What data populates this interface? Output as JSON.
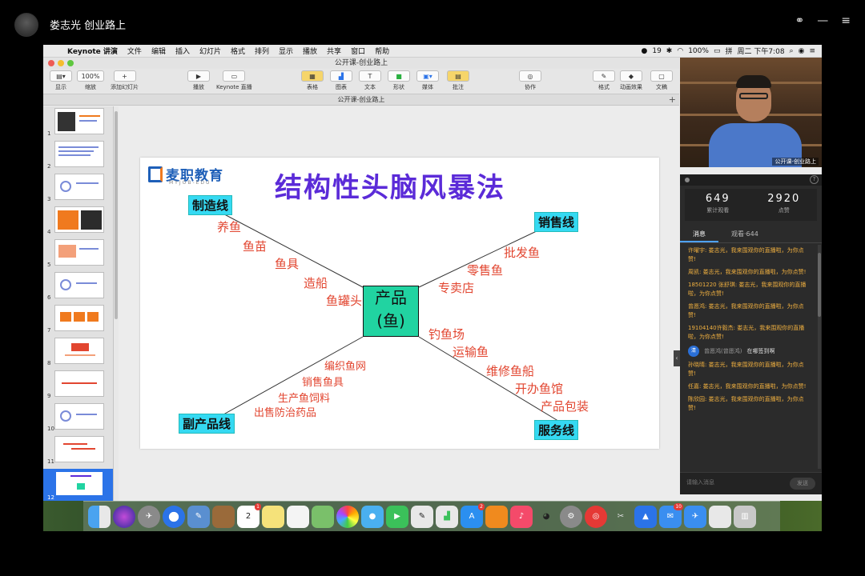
{
  "stream": {
    "host_title": "娄志光 创业路上",
    "icons": [
      "link-icon",
      "minimize-icon",
      "menu-icon"
    ]
  },
  "mac": {
    "menubar": {
      "items": [
        "Keynote 讲演",
        "文件",
        "编辑",
        "插入",
        "幻灯片",
        "格式",
        "排列",
        "显示",
        "播放",
        "共享",
        "窗口",
        "帮助"
      ],
      "right_items": [
        "19",
        "100%",
        "拼",
        "周二 下午7:08"
      ]
    },
    "window_title": "公开课-创业路上",
    "toolbar": {
      "view": "显示",
      "zoom_value": "100%",
      "zoom": "缩放",
      "add_slide": "添加幻灯片",
      "play": "播放",
      "keynote_live": "Keynote 直播",
      "table": "表格",
      "chart": "图表",
      "text": "文本",
      "shape": "形状",
      "media": "媒体",
      "comment": "批注",
      "collaborate": "协作",
      "format": "格式",
      "animate": "动画效果",
      "document": "文稿"
    },
    "doc_tab": "公开课-创业路上",
    "slide_numbers": [
      "1",
      "2",
      "3",
      "4",
      "5",
      "6",
      "7",
      "8",
      "9",
      "10",
      "11",
      "12"
    ],
    "selected_slide": "12",
    "slide": {
      "logo_text": "麦职教育",
      "logo_sub": "MYJOB-EDU",
      "title": "结构性头脑风暴法",
      "center_line1": "产品",
      "center_line2": "(鱼)",
      "categories": {
        "top_left": "制造线",
        "top_right": "销售线",
        "bottom_left": "副产品线",
        "bottom_right": "服务线"
      },
      "items_top_left": [
        "养鱼",
        "鱼苗",
        "鱼具",
        "造船",
        "鱼罐头"
      ],
      "items_top_right": [
        "批发鱼",
        "零售鱼",
        "专卖店"
      ],
      "items_bottom_left": [
        "编织鱼网",
        "销售鱼具",
        "生产鱼饲料",
        "出售防治药品"
      ],
      "items_bottom_right": [
        "钓鱼场",
        "运输鱼",
        "维修鱼船",
        "开办鱼馆",
        "产品包装"
      ]
    },
    "webcam_caption": "公开课-创业路上",
    "chat": {
      "views": "649",
      "views_label": "累计观看",
      "likes": "2920",
      "likes_label": "点赞",
      "tab_messages": "消息",
      "tab_viewers": "观看·644",
      "messages": [
        "许曜宇: 娄志光，我来围观你的直播啦，为你点赞!",
        "周凯: 娄志光，我来围观你的直播啦，为你点赞!",
        "18501220 张舒琪: 娄志光，我来围观你的直播啦，为你点赞!",
        "曾愿鸿: 娄志光，我来围观你的直播啦，为你点赞!",
        "19104140许毅杰: 娄志光，我来围观你的直播啦，为你点赞!"
      ],
      "sys_avatar": "清",
      "sys_name": "曾愿鸿(曾愿鸿)",
      "sys_text": "在哪签到啊",
      "messages_after": [
        "孙晓晴: 娄志光，我来围观你的直播啦，为你点赞!",
        "任嘉: 娄志光，我来围观你的直播啦，为你点赞!",
        "陈欣园: 娄志光，我来围观你的直播啦，为你点赞!"
      ],
      "input_placeholder": "请输入消息",
      "send": "发送"
    },
    "dock": {
      "calendar_day": "2",
      "calendar_badge": "1",
      "appstore_badge": "2",
      "mail_badge": "10"
    }
  },
  "colors": {
    "category_fill": "#35d9f2",
    "center_fill": "#21d3a1",
    "title": "#5b2bd8",
    "branch_text": "#e24630",
    "selected_thumb": "#2b73e8"
  }
}
